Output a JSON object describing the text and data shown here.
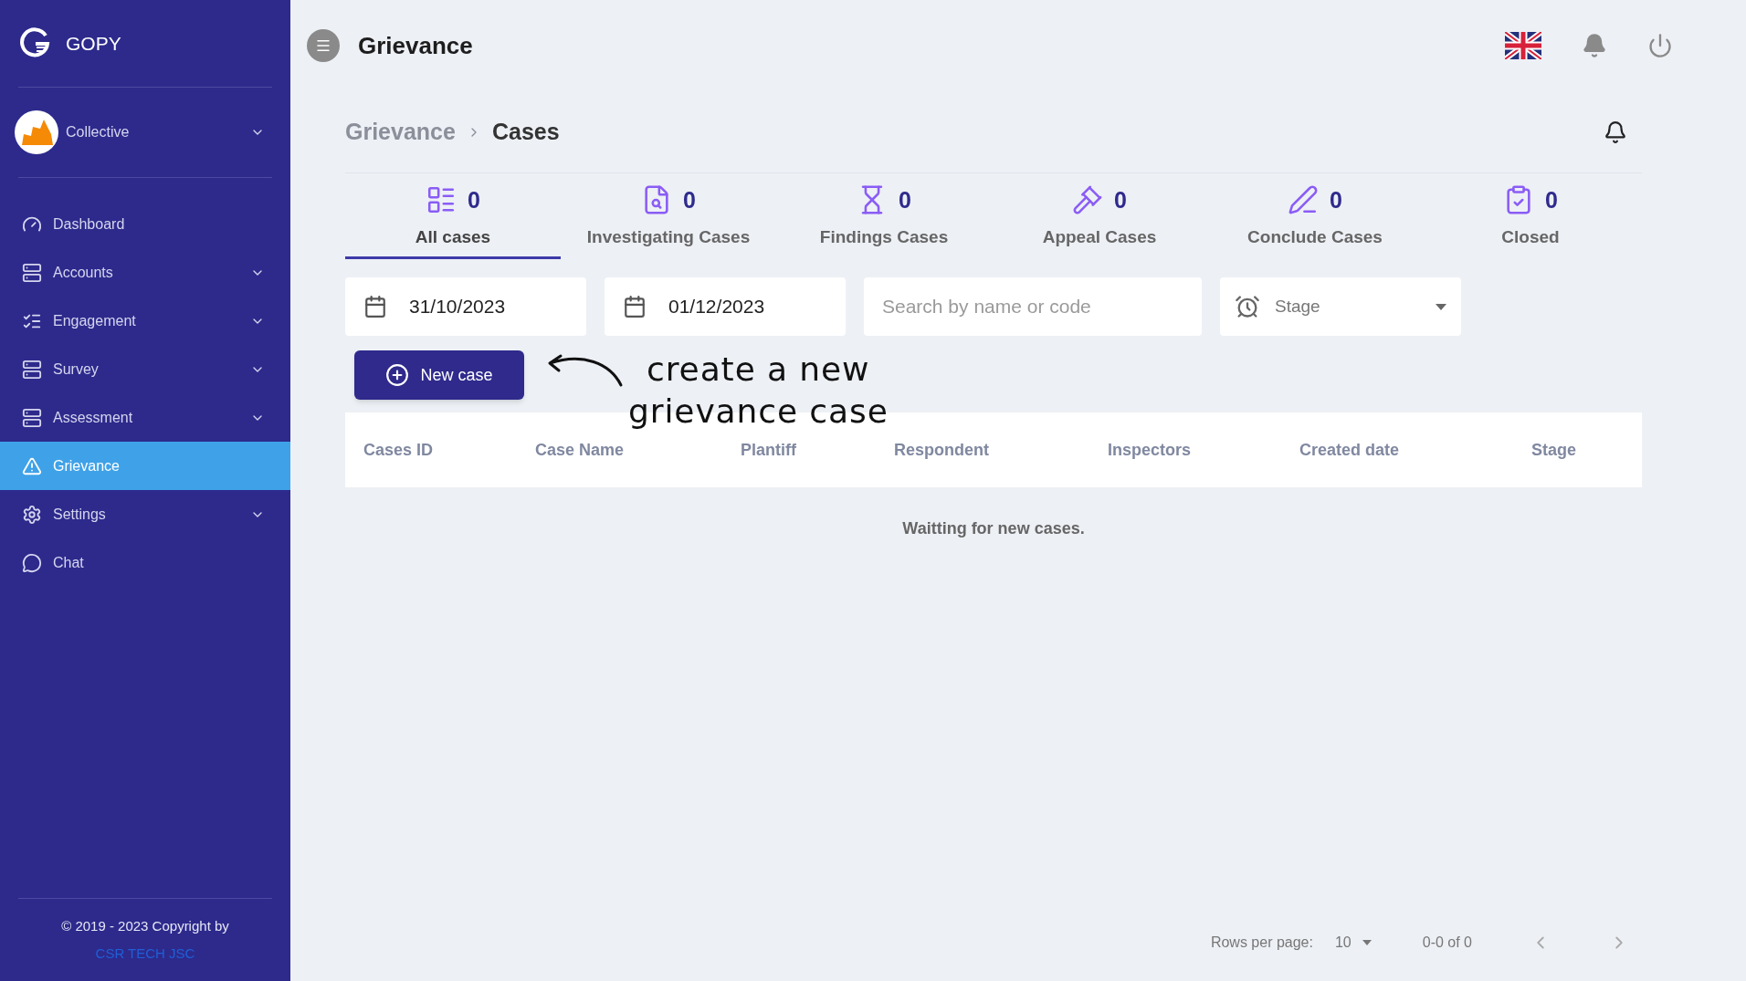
{
  "brand": {
    "name": "GOPY"
  },
  "organization": {
    "name": "Collective"
  },
  "sidebar": {
    "items": [
      {
        "label": "Dashboard",
        "selected": false,
        "has_submenu": false
      },
      {
        "label": "Accounts",
        "selected": false,
        "has_submenu": true
      },
      {
        "label": "Engagement",
        "selected": false,
        "has_submenu": true
      },
      {
        "label": "Survey",
        "selected": false,
        "has_submenu": true
      },
      {
        "label": "Assessment",
        "selected": false,
        "has_submenu": true
      },
      {
        "label": "Grievance",
        "selected": true,
        "has_submenu": false
      },
      {
        "label": "Settings",
        "selected": false,
        "has_submenu": true
      },
      {
        "label": "Chat",
        "selected": false,
        "has_submenu": false
      }
    ]
  },
  "footer": {
    "copyright": "© 2019 - 2023 Copyright by",
    "company_link": "CSR TECH JSC"
  },
  "header": {
    "title": "Grievance"
  },
  "breadcrumb": [
    "Grievance",
    "Cases"
  ],
  "tabs": [
    {
      "label": "All cases",
      "count": "0",
      "selected": true
    },
    {
      "label": "Investigating Cases",
      "count": "0",
      "selected": false
    },
    {
      "label": "Findings Cases",
      "count": "0",
      "selected": false
    },
    {
      "label": "Appeal Cases",
      "count": "0",
      "selected": false
    },
    {
      "label": "Conclude Cases",
      "count": "0",
      "selected": false
    },
    {
      "label": "Closed",
      "count": "0",
      "selected": false
    }
  ],
  "filters": {
    "date_from": "31/10/2023",
    "date_to": "01/12/2023",
    "search": {
      "placeholder": "Search by name or code"
    },
    "stage": {
      "placeholder": "Stage"
    }
  },
  "new_case_button": "New case",
  "annotation": [
    "create a new",
    "grievance case"
  ],
  "table": {
    "columns": [
      "Cases ID",
      "Case Name",
      "Plantiff",
      "Respondent",
      "Inspectors",
      "Created date",
      "Stage"
    ],
    "empty_message": "Waitting for new cases."
  },
  "pagination": {
    "rows_per_page_label": "Rows per page:",
    "rows_per_page": "10",
    "range": "0-0 of 0"
  }
}
